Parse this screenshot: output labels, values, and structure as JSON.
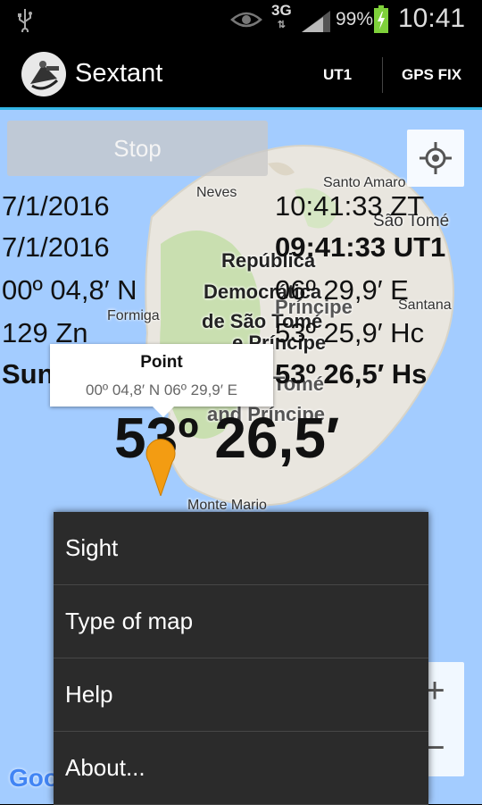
{
  "status_bar": {
    "network": "3G",
    "network_sub": "⇅",
    "battery_percent": "99%",
    "time": "10:41",
    "icons": [
      "usb-icon",
      "eye-icon",
      "signal-icon",
      "battery-charging-icon"
    ]
  },
  "action_bar": {
    "title": "Sextant",
    "action_ut1": "UT1",
    "action_gps_fix": "GPS FIX"
  },
  "map": {
    "labels": {
      "santo_amaro": "Santo Amaro",
      "neves": "Neves",
      "sao_tome": "São Tomé",
      "santana": "Santana",
      "formiga": "Formiga",
      "monte_mario": "Monte Mario",
      "country": [
        "República",
        "Democrática",
        "de São Tomé",
        "e Príncipe"
      ],
      "region": [
        "Príncipe",
        "Tomé",
        "and Príncipe"
      ]
    },
    "stop_button": "Stop",
    "zoom_in": "+",
    "zoom_out": "−",
    "attribution": "Google"
  },
  "overlay": {
    "date_zt": "7/1/2016",
    "time_zt": "10:41:33 ZT",
    "date_ut1": "7/1/2016",
    "time_ut1": "09:41:33 UT1",
    "latitude": "00º 04,8′ N",
    "longitude": "06º 29,9′ E",
    "azimuth": "129 Zn",
    "hc": "53º 25,9′ Hc",
    "body": "Sun C BH",
    "hs": "53º 26,5′ Hs",
    "big_altitude": "53º 26,5′"
  },
  "marker_callout": {
    "title": "Point",
    "coords": "00º 04,8′ N   06º 29,9′ E"
  },
  "menu": {
    "items": [
      "Sight",
      "Type of map",
      "Help",
      "About..."
    ]
  },
  "colors": {
    "accent": "#33b5e5",
    "water": "#a3ccff",
    "land": "#e9e6df",
    "forest": "#c9dfb0",
    "menu_bg": "#2b2b2b",
    "marker": "#f39c12"
  }
}
